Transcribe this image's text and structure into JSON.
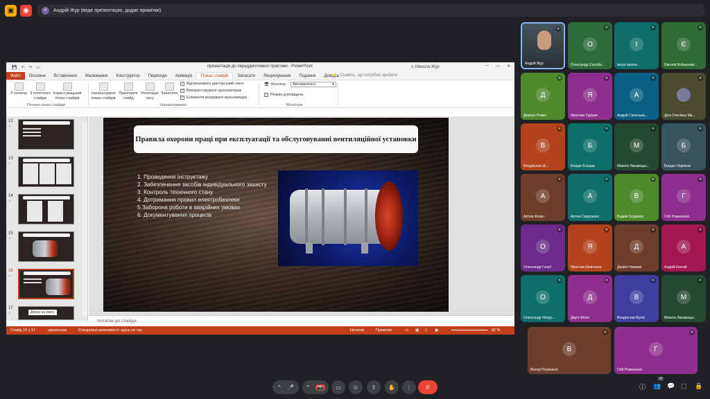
{
  "topbar": {
    "presenter_label": "Андрій Жур (веде презентацію, додає примітки)",
    "presenter_initial": "A",
    "icons": [
      "present-icon",
      "record-icon"
    ],
    "colors": {
      "present": "#f9ab00",
      "record": "#ea4335"
    }
  },
  "ppt": {
    "doc_title": "презентація до переддипломної практики  -  PowerPoint",
    "quick_access": [
      "💾",
      "↶",
      "↷",
      "▭"
    ],
    "user": "⚠  Микола Жур",
    "window_controls": [
      "—",
      "▭",
      "✕"
    ],
    "tabs": [
      "Файл",
      "Основне",
      "Вставлення",
      "Малювання",
      "Конструктор",
      "Переходи",
      "Анімація",
      "Показ слайдів",
      "Записати",
      "Рецензування",
      "Подання",
      "Довідка"
    ],
    "active_tab": "Показ слайдів",
    "search_placeholder": "Скажіть, що потрібно зробити",
    "ribbon": {
      "btn_from_start": "З початку",
      "btn_from_current": "З поточного слайда",
      "btn_custom": "Користувацький показ слайдів",
      "group1": "Почати показ слайдів",
      "btn_setup": "Налаштувати показ слайдів",
      "btn_hide": "Приховати слайд",
      "btn_rehearse": "Репетиція часу",
      "btn_record": "Записати",
      "chk_narration": "Відтворювати дикторський текст",
      "chk_timings": "Використовувати хронометраж",
      "chk_media": "Елементи керування мультимедіа",
      "group2": "Налаштування",
      "monitor_label": "Монітор:",
      "monitor_value": "Автоматично",
      "chk_presenter": "Режим доповідача",
      "group3": "Монітори"
    },
    "thumbnails": [
      {
        "num": "12",
        "star": "*"
      },
      {
        "num": "13",
        "star": "*"
      },
      {
        "num": "14",
        "star": "*"
      },
      {
        "num": "15",
        "star": "*"
      },
      {
        "num": "16",
        "star": "*"
      },
      {
        "num": "17",
        "star": "*"
      }
    ],
    "thumb_tooltip": "Дякую за увагу",
    "slide": {
      "title": "Правила охорони праці при експлуатації та обслуговуванні вентиляційної установки",
      "bullets": [
        "1. Проведення інструктажу",
        "2. Забезпечення засобів індивідуального захисту",
        "3. Контроль технічного стану",
        "4. Дотримання правил електробезпеки",
        "5.Заборона роботи в аварійних умовах",
        "6. Документування процесів"
      ]
    },
    "notes_placeholder": "Нотатки до слайда",
    "status": {
      "slide_count": "Слайд 16 з 17",
      "language": "українська",
      "accessibility": "Спеціальні можливості: щось не так",
      "notes_btn": "Нотатки",
      "comments_btn": "Примітки",
      "zoom": "82 %"
    },
    "colors": {
      "accent": "#c43e1c"
    }
  },
  "participants": [
    {
      "name": "Андрій Жур",
      "initial": "",
      "color": "#3a4a55",
      "video": true
    },
    {
      "name": "Олександр Сергійо...",
      "initial": "О",
      "color": "#2e6b3a"
    },
    {
      "name": "tanya tataren...",
      "initial": "t",
      "color": "#0e6f6a"
    },
    {
      "name": "Євгеній Войцехове...",
      "initial": "Є",
      "color": "#2f6b34"
    },
    {
      "name": "Дмитро Рожко",
      "initial": "Д",
      "color": "#4f8a2c"
    },
    {
      "name": "Ярослав Туріцов",
      "initial": "Я",
      "color": "#8e2f8f"
    },
    {
      "name": "Андрій Синельни...",
      "initial": "А",
      "color": "#0b5e84"
    },
    {
      "name": "Діна Олегівна Ми...",
      "initial": "",
      "color": "#4b4b2f"
    },
    {
      "name": "Владислав Ш...",
      "initial": "В",
      "color": "#b3431d"
    },
    {
      "name": "Богдан Ельцов",
      "initial": "Б",
      "color": "#0e6f6a"
    },
    {
      "name": "Микита Лакавицьк...",
      "initial": "М",
      "color": "#244b32"
    },
    {
      "name": "Богдан Черніков",
      "initial": "Б",
      "color": "#38545f"
    },
    {
      "name": "Артем Філкін",
      "initial": "А",
      "color": "#6d3e2a"
    },
    {
      "name": "Артем Сидоренко",
      "initial": "А",
      "color": "#0e6f6a"
    },
    {
      "name": "Вадим Сєрдюкін",
      "initial": "В",
      "color": "#4f8a2c"
    },
    {
      "name": "Гліб Романенко",
      "initial": "Г",
      "color": "#8e2f8f"
    },
    {
      "name": "Олександр Голуб",
      "initial": "О",
      "color": "#6a2b8a"
    },
    {
      "name": "Ярослав Шевченко",
      "initial": "Я",
      "color": "#b3431d"
    },
    {
      "name": "Даниїл Наумов",
      "initial": "Д",
      "color": "#6d3e2a"
    },
    {
      "name": "Андрій Кисгий",
      "initial": "А",
      "color": "#a2184e"
    },
    {
      "name": "Олександр Чепур...",
      "initial": "О",
      "color": "#0e6f6a"
    },
    {
      "name": "Дар'я Фісан",
      "initial": "Д",
      "color": "#8e2f8f"
    },
    {
      "name": "Владислав Мулік",
      "initial": "В",
      "color": "#3e3f9e"
    },
    {
      "name": "Микита Лакавицьк...",
      "initial": "М",
      "color": "#244b32"
    },
    {
      "name": "Віктор Плужнікое",
      "initial": "В",
      "color": "#6d3e2a"
    },
    {
      "name": "Гліб Романенко",
      "initial": "Г",
      "color": "#8e2f8f"
    }
  ],
  "toolbar": {
    "buttons": [
      "⌃",
      "🎤",
      "⌃",
      "📷",
      "▭",
      "☺",
      "⇧",
      "✋",
      "⋮",
      "✆"
    ],
    "participants_count": "28",
    "right_icons": [
      "ⓘ",
      "👥",
      "💬",
      "⬚",
      "🔒"
    ]
  }
}
